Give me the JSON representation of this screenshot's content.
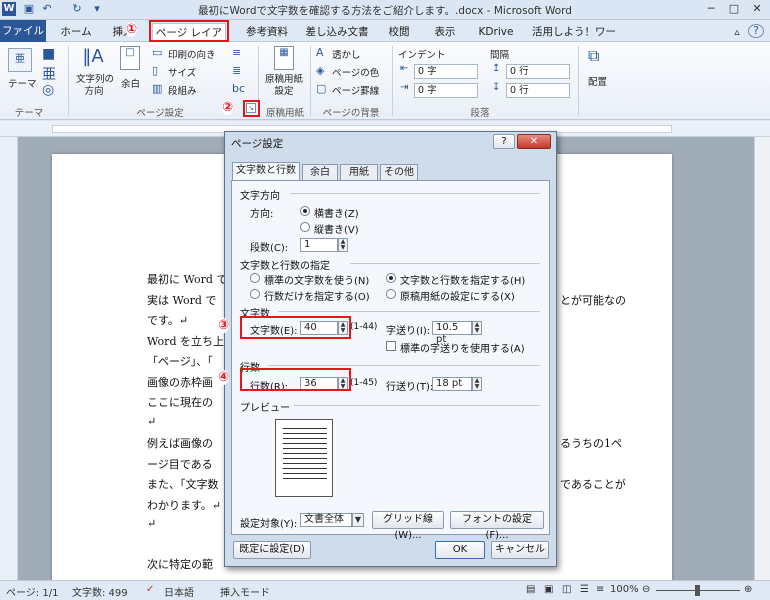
{
  "window": {
    "title": "最初にWordで文字数を確認する方法をご紹介します。.docx - Microsoft Word",
    "minimize": "─",
    "maximize": "□",
    "close": "✕",
    "help": "?"
  },
  "tabs": [
    "ファイル",
    "ホーム",
    "挿入",
    "ページ レイアウト",
    "参考資料",
    "差し込み文書",
    "校閲",
    "表示",
    "KDrive",
    "活用しよう！ワード"
  ],
  "markers": [
    "①",
    "②",
    "③",
    "④"
  ],
  "ribbon": {
    "theme": {
      "label": "テーマ",
      "group": "テーマ"
    },
    "page_setup": {
      "direction": "文字列の\n方向",
      "margin": "余白",
      "print_orientation": "印刷の向き",
      "size": "サイズ",
      "columns": "段組み",
      "group": "ページ設定"
    },
    "manuscript": {
      "btn": "原稿用紙\n設定",
      "group": "原稿用紙"
    },
    "background": {
      "watermark": "透かし",
      "page_color": "ページの色",
      "page_border": "ページ罫線",
      "group": "ページの背景"
    },
    "indent": {
      "header": "インデント",
      "left": "0 字",
      "right": "0 字"
    },
    "spacing": {
      "header": "間隔",
      "before": "0 行",
      "after": "0 行"
    },
    "paragraph_group": "段落",
    "arrange": {
      "label": "配置"
    }
  },
  "document": {
    "lines": [
      "最初に Word で",
      "実は Word で",
      "です。↵",
      "Word を立ち上",
      "「ページ」、「",
      "画像の赤枠画",
      "ここに現在の",
      "↵",
      "例えば画像の",
      "ージ目である",
      "また、「文字数",
      "わかります。↵",
      "↵",
      "次に特定の範"
    ],
    "right_lines": [
      "とが可能なの",
      "るうちの1ペ",
      "であることが"
    ]
  },
  "status": {
    "page": "ページ: 1/1",
    "words": "文字数: 499",
    "lang": "日本語",
    "mode": "挿入モード",
    "zoom": "100%"
  },
  "dialog": {
    "title": "ページ設定",
    "help": "?",
    "close": "✕",
    "tabs": [
      "文字数と行数",
      "余白",
      "用紙",
      "その他"
    ],
    "direction_section": "文字方向",
    "direction_label": "方向:",
    "horizontal": "横書き(Z)",
    "vertical": "縦書き(V)",
    "columns_label": "段数(C):",
    "columns_value": "1",
    "grid_section": "文字数と行数の指定",
    "opt_standard": "標準の文字数を使う(N)",
    "opt_chars_lines": "文字数と行数を指定する(H)",
    "opt_lines_only": "行数だけを指定する(O)",
    "opt_manuscript": "原稿用紙の設定にする(X)",
    "chars_section": "文字数",
    "chars_label": "文字数(E):",
    "chars_value": "40",
    "chars_range": "(1-44)",
    "char_pitch_label": "字送り(I):",
    "char_pitch_value": "10.5 pt",
    "standard_pitch": "標準の字送りを使用する(A)",
    "lines_section": "行数",
    "lines_label": "行数(R):",
    "lines_value": "36",
    "lines_range": "(1-45)",
    "line_pitch_label": "行送り(T):",
    "line_pitch_value": "18 pt",
    "preview_section": "プレビュー",
    "apply_label": "設定対象(Y):",
    "apply_value": "文書全体",
    "grid_btn": "グリッド線(W)...",
    "font_btn": "フォントの設定(F)...",
    "default_btn": "既定に設定(D)",
    "ok_btn": "OK",
    "cancel_btn": "キャンセル"
  },
  "colors": {
    "accent": "#2b5797",
    "highlight": "#e8141b"
  }
}
